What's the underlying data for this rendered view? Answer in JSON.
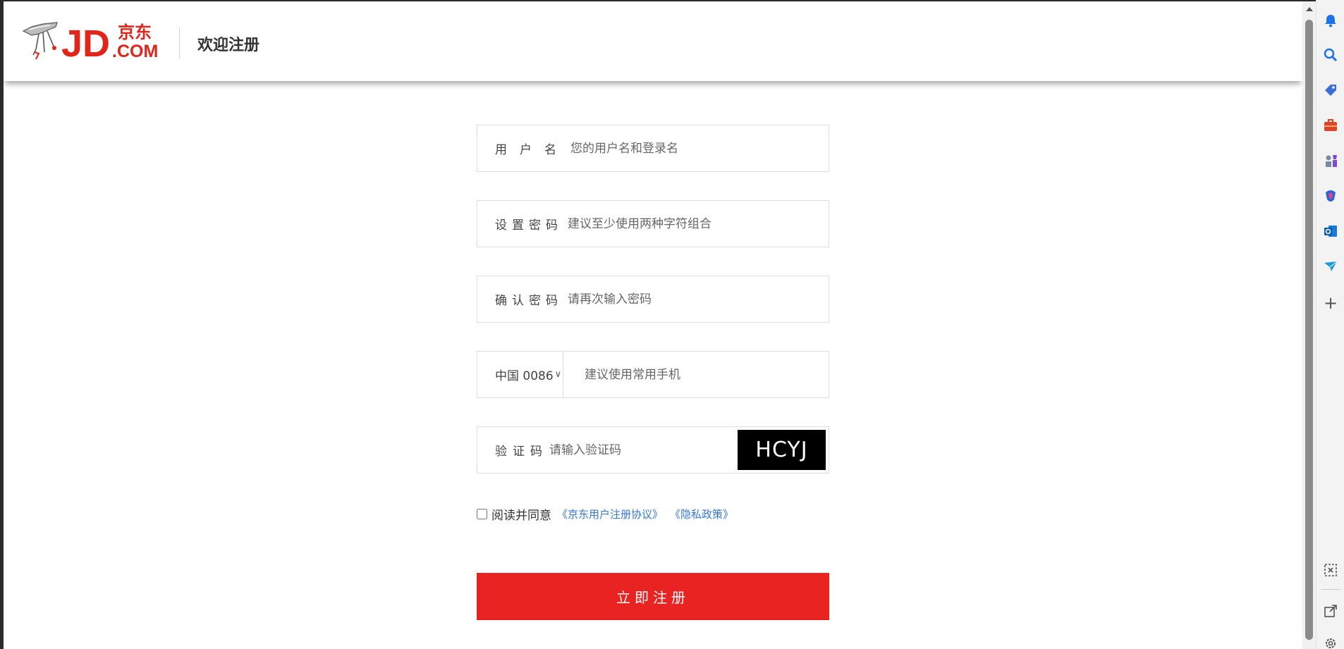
{
  "header": {
    "logo_brand": "JD",
    "logo_cn": "京东",
    "logo_com": ".COM",
    "title": "欢迎注册"
  },
  "form": {
    "username": {
      "label": "用户名",
      "placeholder": "您的用户名和登录名"
    },
    "password": {
      "label": "设置密码",
      "placeholder": "建议至少使用两种字符组合"
    },
    "confirm": {
      "label": "确认密码",
      "placeholder": "请再次输入密码"
    },
    "phone": {
      "country": "中国 0086",
      "chevron": "∨",
      "placeholder": "建议使用常用手机"
    },
    "captcha": {
      "label": "验证码",
      "placeholder": "请输入验证码",
      "image_text": "HCYJ"
    },
    "agree": {
      "text": "阅读并同意",
      "terms_link": "《京东用户注册协议》",
      "privacy_link": "《隐私政策》"
    },
    "submit_label": "立即注册"
  },
  "sidebar": {
    "icons": [
      "bell-icon",
      "search-icon",
      "tag-icon",
      "briefcase-icon",
      "chess-icon",
      "copilot-icon",
      "outlook-icon",
      "send-icon",
      "plus-icon",
      "screenshot-icon",
      "external-link-icon",
      "settings-icon"
    ],
    "plus_glyph": "+"
  },
  "colors": {
    "accent_red": "#e92222",
    "link_blue": "#3777d8",
    "logo_red": "#e1251b"
  }
}
